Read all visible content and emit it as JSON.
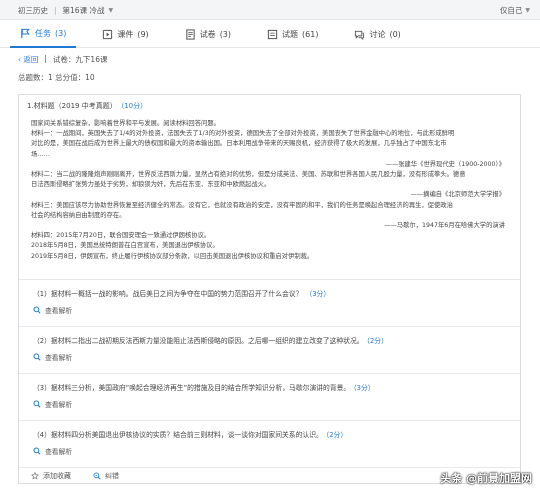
{
  "breadcrumb": {
    "subject": "初三历史",
    "lesson": "第16课 冷战"
  },
  "user": {
    "name": "仅自己"
  },
  "tabs": [
    {
      "label": "任务",
      "count": "(3)",
      "icon": "flag-icon"
    },
    {
      "label": "课件",
      "count": "(9)",
      "icon": "courseware-icon"
    },
    {
      "label": "试卷",
      "count": "(3)",
      "icon": "paper-icon"
    },
    {
      "label": "试题",
      "count": "(61)",
      "icon": "question-icon"
    },
    {
      "label": "讨论",
      "count": "(0)",
      "icon": "discussion-icon"
    }
  ],
  "nav": {
    "back": "返回",
    "paper": "试卷：九下16课"
  },
  "meta": {
    "summary": "总题数：1  总分值：10"
  },
  "question": {
    "title": "1.材料题（2019 中考真题）",
    "score": "（10分）",
    "material": [
      "国家间关系错综复杂，影响着世界和平与发展。阅读材料回答问题。",
      "材料一：一战期间，英国失去了1/4的对外投资，法国失去了1/3的对外投资，德国失去了全部对外投资，美国丧失了世界金融中心的地位，与此形成鲜明",
      "对比的是，美国在战后成为世界上最大的债权国和最大的资本输出国。日本利用战争带来的天赐良机，经济获得了极大的发展，几乎独占了中国东北市",
      "场……",
      "——张建华《世界现代史（1900-2000）》",
      "材料二：当二战的隆隆炮声刚刚离开，世界反法西斯力量，显然占有绝对的优势，但是分成英法、美国、苏联和世界各国人民几股力量，没有形成拳头。德意",
      "日法西斯侵略扩张势力虽处于劣势，却狼狈为奸，先后在东亚、东亚和中欧燃起战火。",
      "——摘编自《北京师范大学学报》",
      "材料三：美国应该尽力协助世界恢复至经济健全的常态。没有它，也就没有政治的安定，没有牢固的和平，我们的任务是唤起合理经济的再生，促使政治",
      "社会的结构容纳自由制度的存在。",
      "——马歇尔，1947年6月在哈佛大学的演讲",
      "材料四：2015年7月20日，联合国安理会一致通过伊朗核协议。",
      "2018年5月8日，美国总统特朗普在白宫宣布，美国退出伊核协议。",
      "2019年5月8日，伊朗宣布，终止履行伊核协议部分条款，以回击美国退出伊核协议和重启对伊制裁。"
    ],
    "subquestions": [
      {
        "text": "（1）据材料一概括一战的影响。战后美日之间为争夺在中国的势力范围召开了什么会议？",
        "points": "（3分）",
        "analysis": "查看解析"
      },
      {
        "text": "（2）据材料二指出二战初期反法西斯力量没能阻止法西斯侵略的原因。之后哪一组织的建立改变了这种状况。",
        "points": "（2分）",
        "analysis": "查看解析"
      },
      {
        "text": "（3）据材料三分析，美国政府“唤起合理经济再生”的措施及目的结合所学知识分析，马歇尔演讲的背景。",
        "points": "（3分）",
        "analysis": "查看解析"
      },
      {
        "text": "（4）据材料四分析美国退出伊核协议的实质？结合前三则材料，谈一谈你对国家间关系的认识。",
        "points": "（2分）",
        "analysis": "查看解析"
      }
    ]
  },
  "footer": {
    "favorite": "添加收藏",
    "report": "纠错"
  },
  "watermark": {
    "text": "头条 @前景加盟网"
  },
  "colors": {
    "accent": "#1f7ad6",
    "border": "#d9dce0"
  }
}
